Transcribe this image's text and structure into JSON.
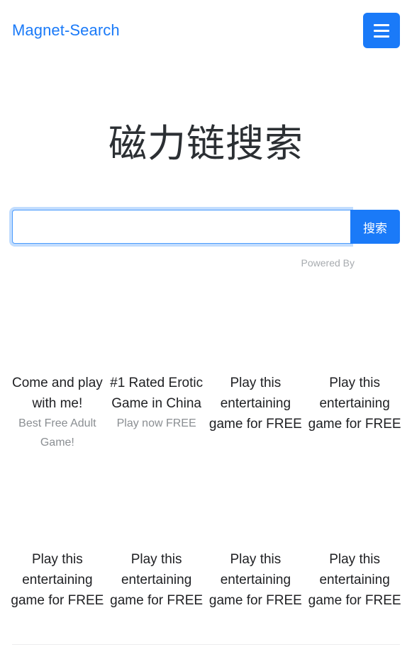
{
  "navbar": {
    "brand": "Magnet-Search",
    "toggler_icon": "hamburger-menu-icon",
    "accent_color": "#1a7af8"
  },
  "hero": {
    "title": "磁力链搜索"
  },
  "search": {
    "value": "",
    "placeholder": "",
    "button_label": "搜索",
    "focused": true
  },
  "ads": {
    "powered_by_label": "Powered By",
    "items": [
      {
        "title": "Come and play with me!",
        "subtitle": "Best Free Adult Game!"
      },
      {
        "title": "#1 Rated Erotic Game in China",
        "subtitle": "Play now FREE"
      },
      {
        "title": "Play this entertaining game for FREE",
        "subtitle": ""
      },
      {
        "title": "Play this entertaining game for FREE",
        "subtitle": ""
      },
      {
        "title": "Play this entertaining game for FREE",
        "subtitle": ""
      },
      {
        "title": "Play this entertaining game for FREE",
        "subtitle": ""
      },
      {
        "title": "Play this entertaining game for FREE",
        "subtitle": ""
      },
      {
        "title": "Play this entertaining game for FREE",
        "subtitle": ""
      }
    ]
  }
}
